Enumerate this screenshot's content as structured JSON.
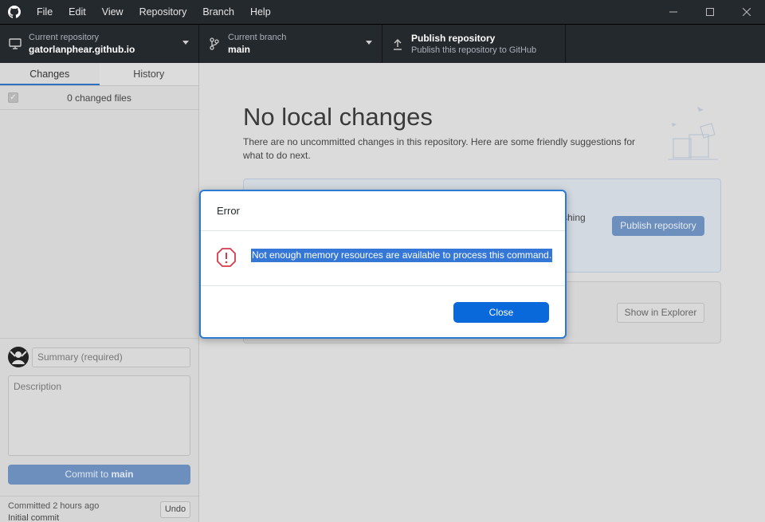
{
  "menu": [
    "File",
    "Edit",
    "View",
    "Repository",
    "Branch",
    "Help"
  ],
  "toolbar": {
    "repo_label": "Current repository",
    "repo_value": "gatorlanphear.github.io",
    "branch_label": "Current branch",
    "branch_value": "main",
    "publish_title": "Publish repository",
    "publish_sub": "Publish this repository to GitHub"
  },
  "sidebar": {
    "tabs": [
      "Changes",
      "History"
    ],
    "changed_files": "0 changed files",
    "summary_placeholder": "Summary (required)",
    "description_placeholder": "Description",
    "commit_prefix": "Commit to ",
    "commit_branch": "main",
    "last_commit_time": "Committed 2 hours ago",
    "last_commit_msg": "Initial commit",
    "undo_label": "Undo"
  },
  "main": {
    "title": "No local changes",
    "intro": "There are no uncommitted changes in this repository. Here are some friendly suggestions for what to do next.",
    "card1_partial_text": "shing",
    "publish_button": "Publish repository",
    "explorer_button": "Show in Explorer"
  },
  "dialog": {
    "title": "Error",
    "message": "Not enough memory resources are available to process this command.",
    "close_label": "Close"
  },
  "colors": {
    "accent": "#0969da",
    "titlebar": "#24292e",
    "error_icon": "#d73a49"
  }
}
